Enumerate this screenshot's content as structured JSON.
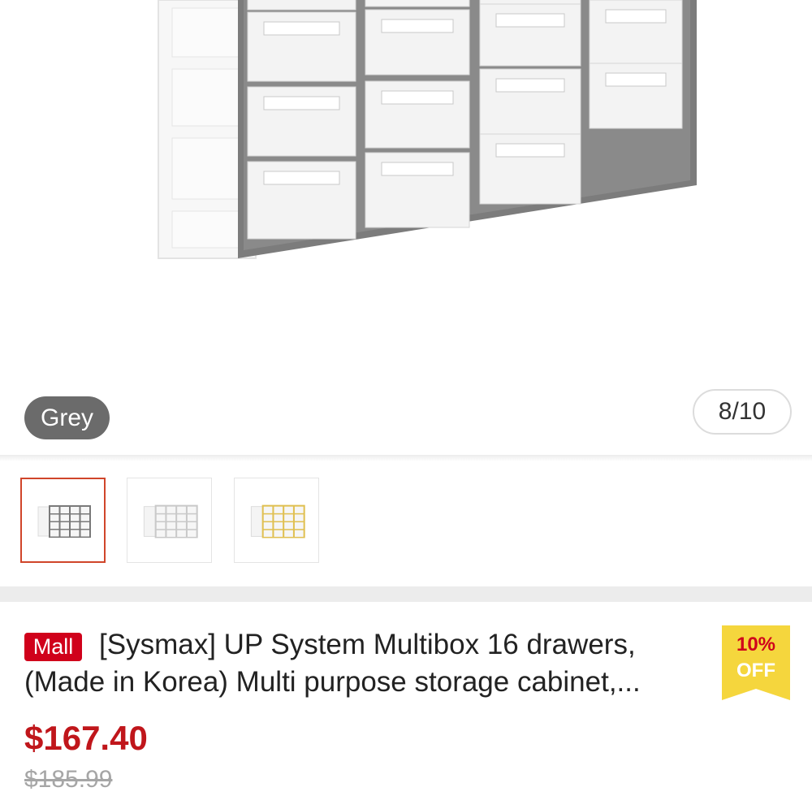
{
  "gallery": {
    "variant_label": "Grey",
    "counter": "8/10",
    "image_name": "multibox-grey-image",
    "thumbnails": [
      {
        "variant": "grey",
        "selected": true
      },
      {
        "variant": "white",
        "selected": false
      },
      {
        "variant": "yellow",
        "selected": false
      }
    ]
  },
  "product": {
    "mall_badge": "Mall",
    "title_line1": "[Sysmax] UP System Multibox 16 drawers,",
    "title_line2": "(Made in Korea) Multi purpose storage cabinet,...",
    "discount_percent": "10%",
    "discount_off": "OFF",
    "price": "$167.40",
    "original_price": "$185.99"
  },
  "colors": {
    "accent": "#d0011b",
    "price": "#c0161b",
    "discount_badge": "#f5d63d",
    "selected_border": "#d0452a"
  }
}
